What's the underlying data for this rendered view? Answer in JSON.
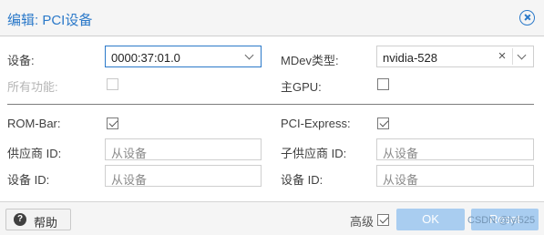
{
  "dialog": {
    "title": "编辑: PCI设备"
  },
  "form": {
    "device": {
      "label": "设备:",
      "value": "0000:37:01.0"
    },
    "all_functions": {
      "label": "所有功能:",
      "checked": false,
      "disabled": true
    },
    "mdev_type": {
      "label": "MDev类型:",
      "value": "nvidia-528"
    },
    "primary_gpu": {
      "label": "主GPU:",
      "checked": false
    },
    "rom_bar": {
      "label": "ROM-Bar:",
      "checked": true
    },
    "pci_express": {
      "label": "PCI-Express:",
      "checked": true
    },
    "vendor_id": {
      "label": "供应商 ID:",
      "placeholder": "从设备"
    },
    "sub_vendor_id": {
      "label": "子供应商 ID:",
      "placeholder": "从设备"
    },
    "device_id": {
      "label": "设备 ID:",
      "placeholder": "从设备"
    },
    "sub_device_id": {
      "label": "设备 ID:",
      "placeholder": "从设备"
    }
  },
  "footer": {
    "help_label": "帮助",
    "advanced_label": "高级",
    "advanced_checked": true,
    "ok_label": "OK",
    "reset_label": "Reset",
    "watermark": "CSDN @lyl525"
  },
  "colors": {
    "accent": "#2b79c9",
    "button_disabled": "#a9cdf0"
  }
}
